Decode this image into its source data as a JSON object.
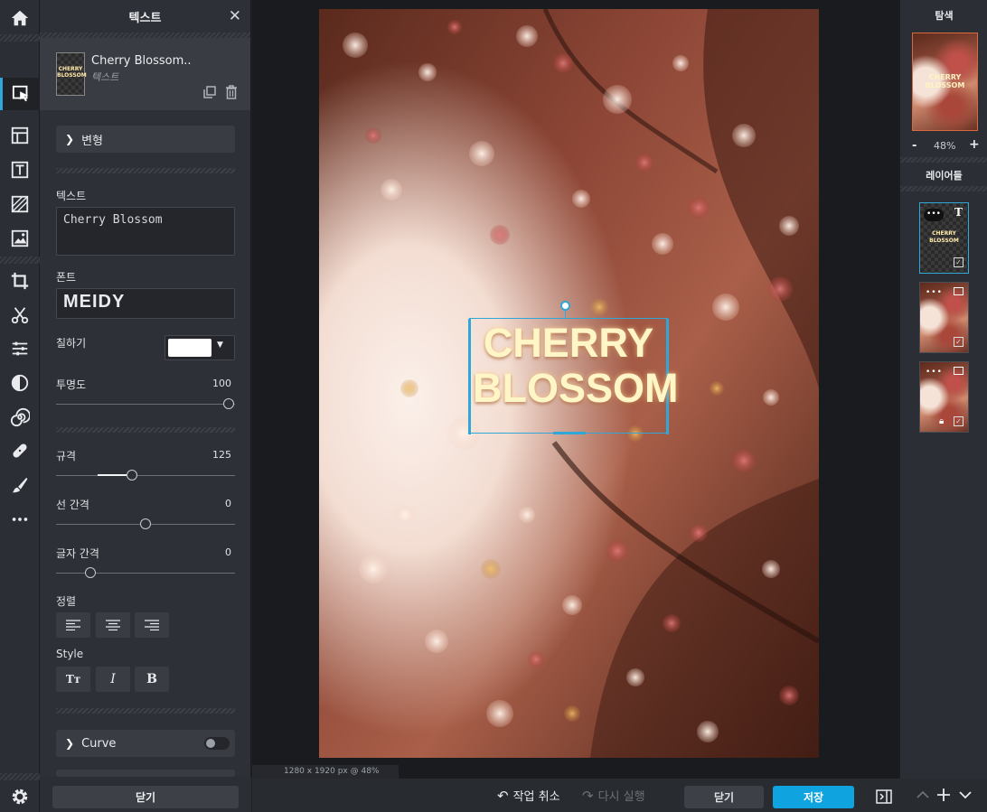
{
  "panel": {
    "title": "텍스트",
    "layer_name": "Cherry Blossom..",
    "layer_type": "텍스트",
    "transform_label": "변형",
    "text_label": "텍스트",
    "text_value": "Cherry Blossom",
    "font_label": "폰트",
    "font_value": "MEIDY",
    "fill_label": "칠하기",
    "fill_color": "#ffffff",
    "opacity_label": "투명도",
    "opacity_value": "100",
    "size_label": "규격",
    "size_value": "125",
    "line_spacing_label": "선 간격",
    "line_spacing_value": "0",
    "letter_spacing_label": "글자 간격",
    "letter_spacing_value": "0",
    "align_label": "정렬",
    "style_label": "Style",
    "style_buttons": [
      "Tт",
      "I",
      "B"
    ],
    "curve_label": "Curve",
    "close_label": "닫기"
  },
  "canvas": {
    "size_readout": "1280 x 1920 px @ 48%",
    "headline_line1": "CHERRY",
    "headline_line2": "BLOSSOM"
  },
  "bottombar": {
    "undo_label": "작업 취소",
    "redo_label": "다시 실행",
    "close_label": "닫기",
    "save_label": "저장"
  },
  "rightpanel": {
    "navigator_title": "탐색",
    "zoom_minus": "-",
    "zoom_value": "48%",
    "zoom_plus": "+",
    "layers_title": "레이어들",
    "thumb_text": "CHERRY BLOSSOM"
  },
  "colors": {
    "accent": "#2fa7d8",
    "save_button": "#0fa3e0",
    "panel_bg": "#2d3036"
  }
}
